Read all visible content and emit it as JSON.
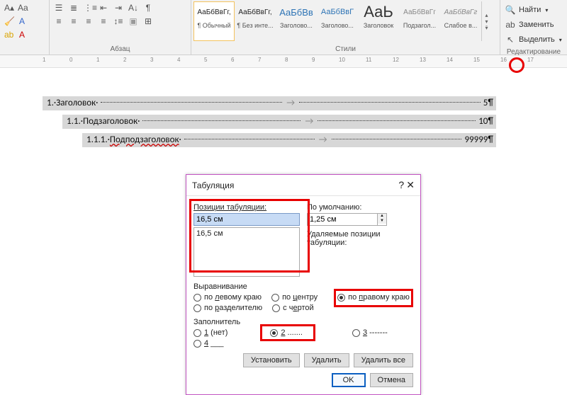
{
  "ribbon": {
    "paragraph_label": "Абзац",
    "styles_label": "Стили",
    "editing_label": "Редактирование",
    "styles": [
      {
        "sample": "АаБбВвГг,",
        "name": "¶ Обычный",
        "sampleColor": "#222",
        "size": "10px",
        "selected": true
      },
      {
        "sample": "АаБбВвГг,",
        "name": "¶ Без инте...",
        "sampleColor": "#222",
        "size": "10px"
      },
      {
        "sample": "АаБбВв",
        "name": "Заголово...",
        "sampleColor": "#2e74b5",
        "size": "13px"
      },
      {
        "sample": "АаБбВвГ",
        "name": "Заголово...",
        "sampleColor": "#2e74b5",
        "size": "11px"
      },
      {
        "sample": "АаЬ",
        "name": "Заголовок",
        "sampleColor": "#333",
        "size": "22px"
      },
      {
        "sample": "АаБбВвГг",
        "name": "Подзагол...",
        "sampleColor": "#888",
        "size": "10px"
      },
      {
        "sample": "АаБбВвГг",
        "name": "Слабое в...",
        "sampleColor": "#888",
        "size": "10px",
        "italic": true
      }
    ],
    "editing": {
      "find": "Найти",
      "replace": "Заменить",
      "select": "Выделить"
    }
  },
  "document": {
    "lines": [
      {
        "num": "1.",
        "text": "Заголовок",
        "tail": "5¶"
      },
      {
        "num": "1.1.",
        "text": "Подзаголовок",
        "tail": "10¶"
      },
      {
        "num": "1.1.1.",
        "text": "Подподзаголовок",
        "tail": "99999¶",
        "wavy": true
      }
    ]
  },
  "dialog": {
    "title": "Табуляция",
    "positions_label": "Позиции табуляции:",
    "default_label": "По умолчанию:",
    "default_value": "1,25 см",
    "clear_label": "Удаляемые позиции табуляции:",
    "tab_value": "16,5 см",
    "tab_list_item": "16,5 см",
    "align_label": "Выравнивание",
    "align": {
      "left": "по левому краю",
      "center": "по центру",
      "right": "по правому краю",
      "decimal": "по разделителю",
      "bar": "с чертой"
    },
    "leader_label": "Заполнитель",
    "leader": {
      "none": "1 (нет)",
      "dots": "2 .......",
      "dashes": "3 -------",
      "under": "4 ___"
    },
    "set": "Установить",
    "clear": "Удалить",
    "clear_all": "Удалить все",
    "ok": "OK",
    "cancel": "Отмена"
  }
}
